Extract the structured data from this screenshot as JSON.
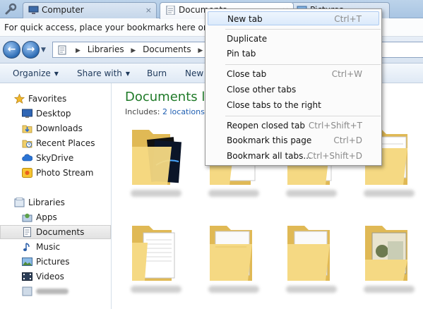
{
  "tabs": [
    {
      "label": "Computer",
      "icon": "computer-icon",
      "close": "×",
      "active": false
    },
    {
      "label": "Documents",
      "icon": "documents-icon",
      "close": "×",
      "active": true
    },
    {
      "label": "Pictures",
      "icon": "pictures-icon",
      "close": "×",
      "active": false
    }
  ],
  "bookmark_bar": {
    "text": "For quick access, place your bookmarks here on the b"
  },
  "address": {
    "back": "←",
    "forward": "→",
    "dropdown": "▼",
    "sep": "▶",
    "crumbs": [
      "Libraries",
      "Documents"
    ]
  },
  "commands": [
    {
      "label": "Organize",
      "caret": "▼"
    },
    {
      "label": "Share with",
      "caret": "▼"
    },
    {
      "label": "Burn",
      "caret": ""
    },
    {
      "label": "New",
      "caret": ""
    }
  ],
  "nav": {
    "favorites_header": "Favorites",
    "favorites": [
      "Desktop",
      "Downloads",
      "Recent Places",
      "SkyDrive",
      "Photo Stream"
    ],
    "libraries_header": "Libraries",
    "libraries": [
      "Apps",
      "Documents",
      "Music",
      "Pictures",
      "Videos"
    ]
  },
  "content": {
    "title": "Documents lib",
    "includes_prefix": "Includes:",
    "includes_link": "2 locations"
  },
  "menu": {
    "items": [
      {
        "label": "New tab",
        "shortcut": "Ctrl+T"
      },
      {
        "label": "Duplicate",
        "shortcut": ""
      },
      {
        "label": "Pin tab",
        "shortcut": ""
      },
      {
        "label": "Close tab",
        "shortcut": "Ctrl+W"
      },
      {
        "label": "Close other tabs",
        "shortcut": ""
      },
      {
        "label": "Close tabs to the right",
        "shortcut": ""
      },
      {
        "label": "Reopen closed tab",
        "shortcut": "Ctrl+Shift+T"
      },
      {
        "label": "Bookmark this page",
        "shortcut": "Ctrl+D"
      },
      {
        "label": "Bookmark all tabs...",
        "shortcut": "Ctrl+Shift+D"
      }
    ]
  },
  "colors": {
    "accent": "#1f7a28",
    "link": "#1f5fb2",
    "folder": "#f3d77c"
  }
}
